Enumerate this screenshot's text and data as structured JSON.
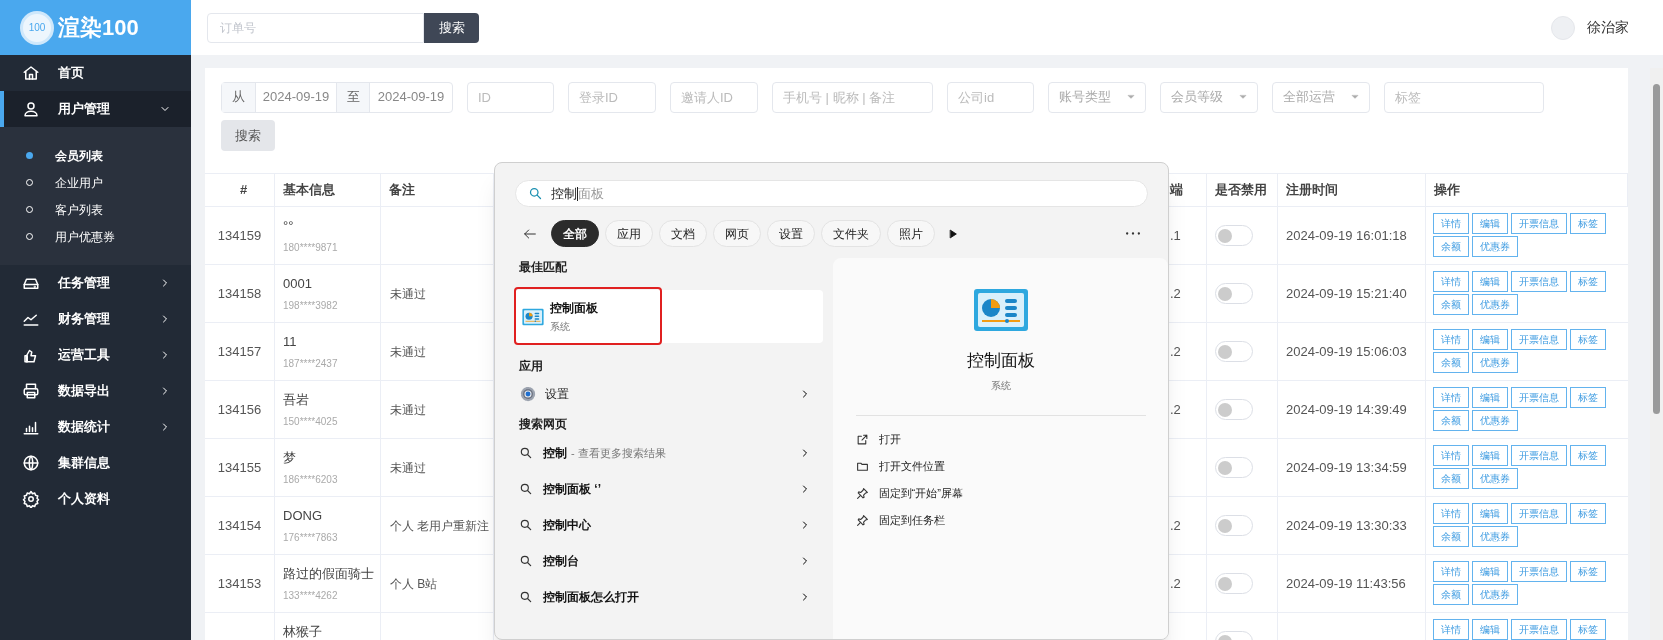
{
  "logo": {
    "badge": "100",
    "text": "渲染100"
  },
  "sidebar": {
    "items": [
      {
        "label": "首页",
        "selected": false
      },
      {
        "label": "用户管理",
        "selected": true,
        "expanded": true,
        "children": [
          {
            "label": "会员列表",
            "selected": true
          },
          {
            "label": "企业用户",
            "selected": false
          },
          {
            "label": "客户列表",
            "selected": false
          },
          {
            "label": "用户优惠券",
            "selected": false
          }
        ]
      },
      {
        "label": "任务管理",
        "selected": false,
        "expanded": false
      },
      {
        "label": "财务管理",
        "selected": false,
        "expanded": false
      },
      {
        "label": "运营工具",
        "selected": false,
        "expanded": false
      },
      {
        "label": "数据导出",
        "selected": false,
        "expanded": false
      },
      {
        "label": "数据统计",
        "selected": false,
        "expanded": false
      },
      {
        "label": "集群信息",
        "selected": false
      },
      {
        "label": "个人资料",
        "selected": false
      }
    ]
  },
  "topbar": {
    "search": {
      "placeholder": "订单号"
    },
    "search_button": "搜索",
    "user": {
      "name": "徐治家"
    }
  },
  "filters": {
    "date_from_label": "从",
    "date_from": "2024-09-19",
    "date_to_label": "至",
    "date_to": "2024-09-19",
    "fields": [
      {
        "kind": "input",
        "placeholder": "ID"
      },
      {
        "kind": "input",
        "placeholder": "登录ID"
      },
      {
        "kind": "input",
        "placeholder": "邀请人ID"
      },
      {
        "kind": "input",
        "placeholder": "手机号 | 昵称 | 备注"
      },
      {
        "kind": "input",
        "placeholder": "公司id"
      },
      {
        "kind": "select",
        "placeholder": "账号类型"
      },
      {
        "kind": "select",
        "placeholder": "会员等级"
      },
      {
        "kind": "select",
        "placeholder": "全部运营"
      },
      {
        "kind": "input",
        "placeholder": "标签"
      }
    ],
    "search_button": "搜索"
  },
  "table": {
    "columns": [
      "#",
      "基本信息",
      "备注",
      "端",
      "是否禁用",
      "注册时间",
      "操作"
    ],
    "rows": [
      {
        "id": "134159",
        "name": "°°",
        "phone": "180****9871",
        "column_4": ".1",
        "disabled": false,
        "registered": "2024-09-19 16:01:18",
        "actions": [
          "详情",
          "编辑",
          "开票信息",
          "标签",
          "余额",
          "优惠券"
        ]
      },
      {
        "id": "134158",
        "name": "0001",
        "phone": "198****3982",
        "note": "未通过",
        "column_4": ".2",
        "disabled": false,
        "registered": "2024-09-19 15:21:40",
        "actions": [
          "详情",
          "编辑",
          "开票信息",
          "标签",
          "余额",
          "优惠券"
        ]
      },
      {
        "id": "134157",
        "name": "11",
        "phone": "187****2437",
        "note": "未通过",
        "column_4": ".2",
        "disabled": false,
        "registered": "2024-09-19 15:06:03",
        "actions": [
          "详情",
          "编辑",
          "开票信息",
          "标签",
          "余额",
          "优惠券"
        ]
      },
      {
        "id": "134156",
        "name": "吾岩",
        "phone": "150****4025",
        "note": "未通过",
        "column_4": ".2",
        "disabled": false,
        "registered": "2024-09-19 14:39:49",
        "actions": [
          "详情",
          "编辑",
          "开票信息",
          "标签",
          "余额",
          "优惠券"
        ]
      },
      {
        "id": "134155",
        "name": "梦",
        "phone": "186****6203",
        "note": "未通过",
        "disabled": false,
        "registered": "2024-09-19 13:34:59",
        "actions": [
          "详情",
          "编辑",
          "开票信息",
          "标签",
          "余额",
          "优惠券"
        ]
      },
      {
        "id": "134154",
        "name": "DONG",
        "phone": "176****7863",
        "note": "个人 老用户重新注",
        "column_4": ".2",
        "disabled": false,
        "registered": "2024-09-19 13:30:33",
        "actions": [
          "详情",
          "编辑",
          "开票信息",
          "标签",
          "余额",
          "优惠券"
        ]
      },
      {
        "id": "134153",
        "name": "路过的假面骑士",
        "phone": "133****4262",
        "note": "个人 B站",
        "column_4": ".2",
        "disabled": false,
        "registered": "2024-09-19 11:43:56",
        "actions": [
          "详情",
          "编辑",
          "开票信息",
          "标签",
          "余额",
          "优惠券"
        ]
      },
      {
        "name": "林猴子",
        "disabled": false,
        "actions": [
          "详情",
          "编辑",
          "开票信息",
          "标签"
        ]
      }
    ]
  },
  "search_panel": {
    "search": {
      "value": "控制",
      "suggestion": "面板"
    },
    "filters": [
      {
        "label": "全部",
        "selected": true
      },
      {
        "label": "应用",
        "selected": false
      },
      {
        "label": "文档",
        "selected": false
      },
      {
        "label": "网页",
        "selected": false
      },
      {
        "label": "设置",
        "selected": false
      },
      {
        "label": "文件夹",
        "selected": false
      },
      {
        "label": "照片",
        "selected": false
      }
    ],
    "best_match": {
      "heading": "最佳匹配",
      "title": "控制面板",
      "subtitle": "系统",
      "highlight_box": true
    },
    "apps": {
      "heading": "应用",
      "items": [
        {
          "label": "设置"
        }
      ]
    },
    "web": {
      "heading": "搜索网页",
      "items": [
        {
          "query": "控制",
          "hint": "- 查看更多搜索结果"
        },
        {
          "query": "控制面板 ‘’"
        },
        {
          "query": "控制中心"
        },
        {
          "query": "控制台"
        },
        {
          "query": "控制面板怎么打开"
        }
      ]
    },
    "preview": {
      "title": "控制面板",
      "subtitle": "系统",
      "actions": [
        "打开",
        "打开文件位置",
        "固定到“开始”屏幕",
        "固定到任务栏"
      ]
    }
  }
}
